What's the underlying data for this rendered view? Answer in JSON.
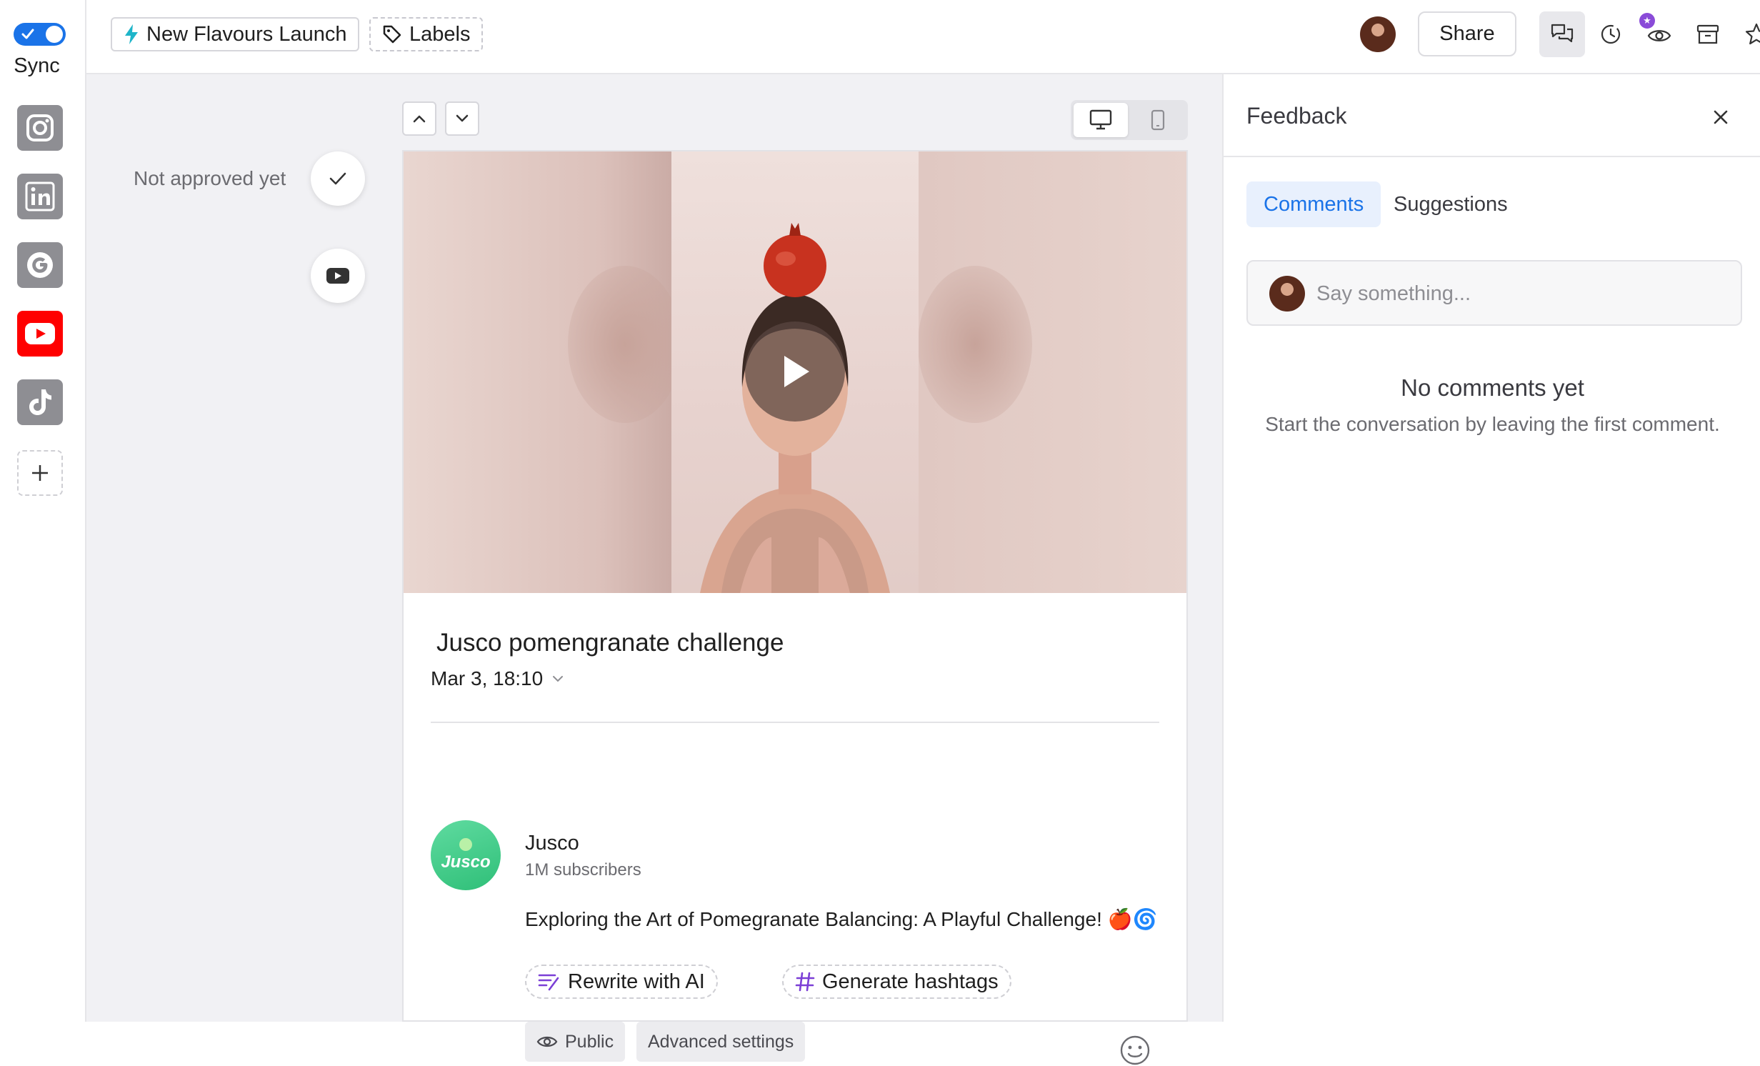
{
  "sidebar": {
    "sync_label": "Sync",
    "sync_enabled": true,
    "channels": [
      {
        "name": "instagram-icon"
      },
      {
        "name": "linkedin-icon"
      },
      {
        "name": "google-icon"
      },
      {
        "name": "youtube-icon",
        "active": true
      },
      {
        "name": "tiktok-icon"
      }
    ],
    "add_icon": "plus-icon"
  },
  "topbar": {
    "campaign_label": "New Flavours Launch",
    "labels_label": "Labels",
    "share_label": "Share",
    "icons": [
      "comments-icon",
      "history-icon",
      "watch-icon",
      "archive-icon",
      "star-icon",
      "more-icon"
    ],
    "accent": "#1a73e8"
  },
  "approval": {
    "status": "Not approved yet"
  },
  "post": {
    "title": "Jusco pomengranate challenge",
    "date": "Mar 3, 18:10",
    "channel_name": "Jusco",
    "channel_avatar_text": "Jusco",
    "subscribers": "1M subscribers",
    "caption": "Exploring the Art of Pomegranate Balancing: A Playful Challenge!",
    "caption_emoji": "🍎🌀",
    "rewrite_label": "Rewrite with AI",
    "hashtags_label": "Generate hashtags",
    "visibility_label": "Public",
    "advanced_label": "Advanced settings"
  },
  "feedback": {
    "title": "Feedback",
    "tabs": [
      {
        "label": "Comments",
        "active": true
      },
      {
        "label": "Suggestions",
        "active": false
      }
    ],
    "comment_placeholder": "Say something...",
    "empty_title": "No comments yet",
    "empty_subtitle": "Start the conversation by leaving the first comment."
  }
}
